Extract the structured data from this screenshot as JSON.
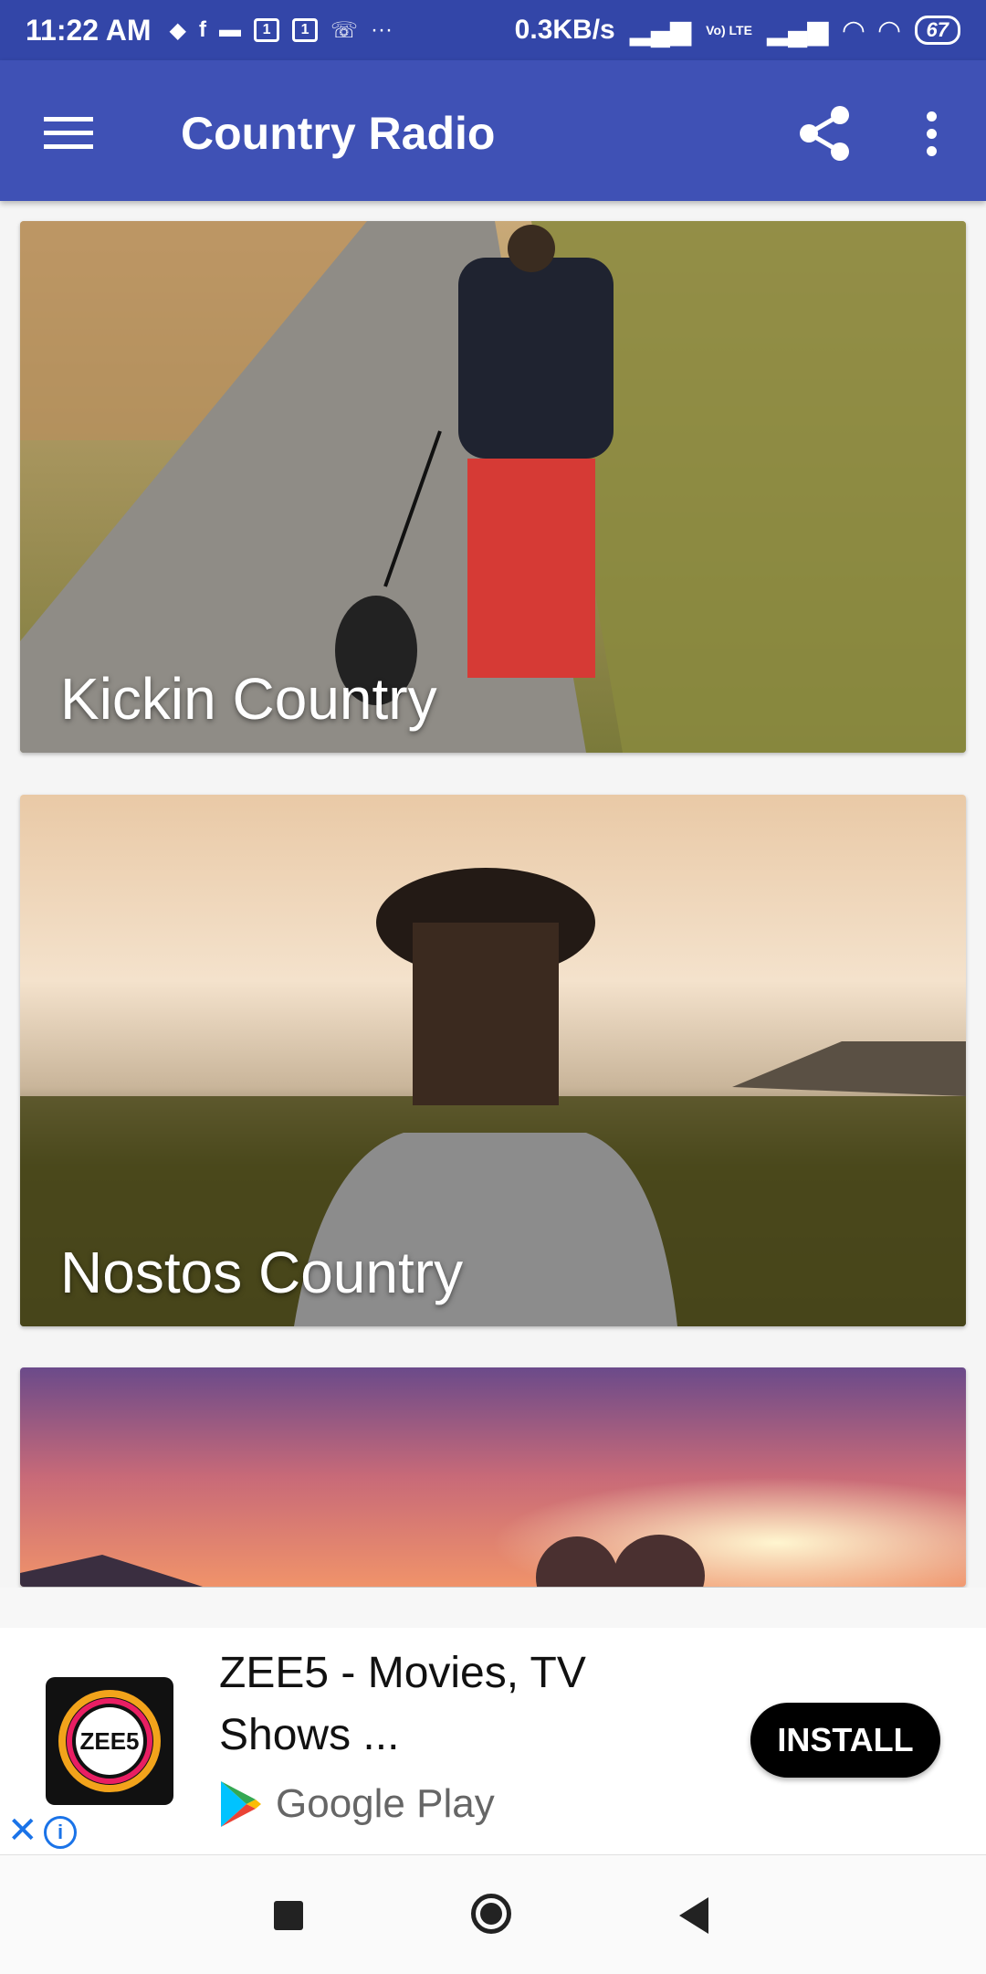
{
  "status_bar": {
    "time": "11:22 AM",
    "speed": "0.3KB/s",
    "network": "Vo) LTE",
    "battery": "67",
    "more": "···"
  },
  "app_bar": {
    "title": "Country Radio",
    "menu_icon": "hamburger-menu-icon",
    "share_icon": "share-icon",
    "more_icon": "overflow-menu-icon"
  },
  "stations": [
    {
      "name": "Kickin Country"
    },
    {
      "name": "Nostos Country"
    },
    {
      "name": ""
    }
  ],
  "ad": {
    "logo_text": "ZEE5",
    "title": "ZEE5 - Movies, TV Shows ...",
    "store": "Google Play",
    "install_label": "INSTALL",
    "close_icon": "close-icon",
    "info_icon": "info-icon"
  },
  "colors": {
    "app_bar": "#3f51b5",
    "status_bar": "#3346a8",
    "install_button": "#000000"
  }
}
